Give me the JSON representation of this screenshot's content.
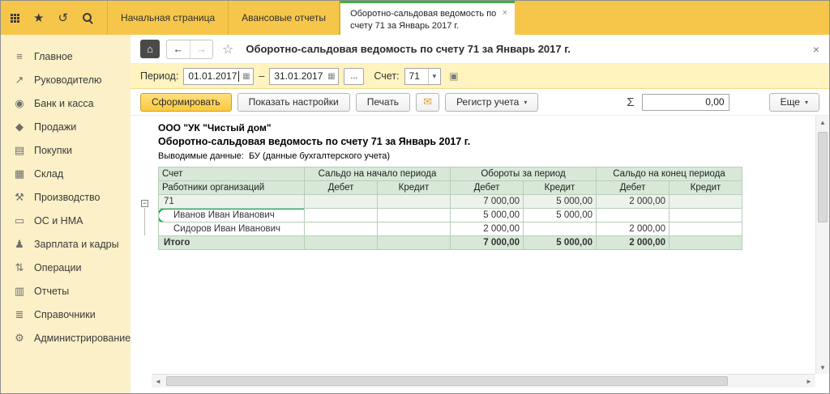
{
  "colors": {
    "topbar_yellow": "#F6C64B",
    "sidebar_yellow": "#FBF0C7",
    "filter_bar_yellow": "#FFF3BF",
    "accent_green": "#3FAE49",
    "highlight_green": "#00B050",
    "table_header_green": "#D7E8D7",
    "primary_button_yellow": "#F9C93F"
  },
  "icons": {
    "apps_grid": "css-grid-dots",
    "favorites_star": "★",
    "history": "↺",
    "search": "css-magnifier",
    "home": "⌂",
    "back": "←",
    "forward": "→",
    "title_star": "☆",
    "close": "×",
    "calendar": "▦",
    "combo_arrow": "▾",
    "open_form": "▣",
    "mail": "✉",
    "sigma": "Σ",
    "dropdown": "▾",
    "expander": "−",
    "up": "▲",
    "down": "▼",
    "left": "◄",
    "right": "►"
  },
  "topbar": {
    "tabs": [
      {
        "label": "Начальная страница"
      },
      {
        "label": "Авансовые отчеты"
      },
      {
        "label": "Оборотно-сальдовая ведомость по счету 71 за Январь 2017 г.",
        "active": true
      }
    ]
  },
  "sidebar": {
    "items": [
      {
        "label": "Главное",
        "icon": "≡"
      },
      {
        "label": "Руководителю",
        "icon": "↗"
      },
      {
        "label": "Банк и касса",
        "icon": "◉"
      },
      {
        "label": "Продажи",
        "icon": "◆"
      },
      {
        "label": "Покупки",
        "icon": "▤"
      },
      {
        "label": "Склад",
        "icon": "▦"
      },
      {
        "label": "Производство",
        "icon": "⚒"
      },
      {
        "label": "ОС и НМА",
        "icon": "▭"
      },
      {
        "label": "Зарплата и кадры",
        "icon": "♟"
      },
      {
        "label": "Операции",
        "icon": "⇅"
      },
      {
        "label": "Отчеты",
        "icon": "▥"
      },
      {
        "label": "Справочники",
        "icon": "≣"
      },
      {
        "label": "Администрирование",
        "icon": "⚙"
      }
    ]
  },
  "nav": {
    "title": "Оборотно-сальдовая ведомость по счету 71 за Январь 2017 г."
  },
  "filters": {
    "period_label": "Период:",
    "date_from": "01.01.2017",
    "range_dash": "–",
    "date_to": "31.01.2017",
    "period_picker_button": "...",
    "account_label": "Счет:",
    "account_value": "71"
  },
  "toolbar": {
    "generate": "Сформировать",
    "show_settings": "Показать настройки",
    "print": "Печать",
    "register": "Регистр учета",
    "sum_value": "0,00",
    "more": "Еще"
  },
  "report": {
    "company": "ООО \"УК \"Чистый дом\"",
    "title": "Оборотно-сальдовая ведомость по счету 71 за Январь 2017 г.",
    "data_note_label": "Выводимые данные:",
    "data_note_value": "БУ (данные бухгалтерского учета)",
    "table": {
      "header": {
        "account": "Счет",
        "account_sub": "Работники организаций",
        "groups": [
          "Сальдо на начало периода",
          "Обороты за период",
          "Сальдо на конец периода"
        ],
        "debit": "Дебет",
        "credit": "Кредит"
      },
      "rows": [
        {
          "name": "71",
          "cells": [
            "",
            "",
            "7 000,00",
            "5 000,00",
            "2 000,00",
            ""
          ]
        },
        {
          "name": "Иванов Иван Иванович",
          "cells": [
            "",
            "",
            "5 000,00",
            "5 000,00",
            "",
            ""
          ]
        },
        {
          "name": "Сидоров Иван Иванович",
          "cells": [
            "",
            "",
            "2 000,00",
            "",
            "2 000,00",
            ""
          ]
        },
        {
          "name": "Итого",
          "cells": [
            "",
            "",
            "7 000,00",
            "5 000,00",
            "2 000,00",
            ""
          ]
        }
      ]
    }
  }
}
